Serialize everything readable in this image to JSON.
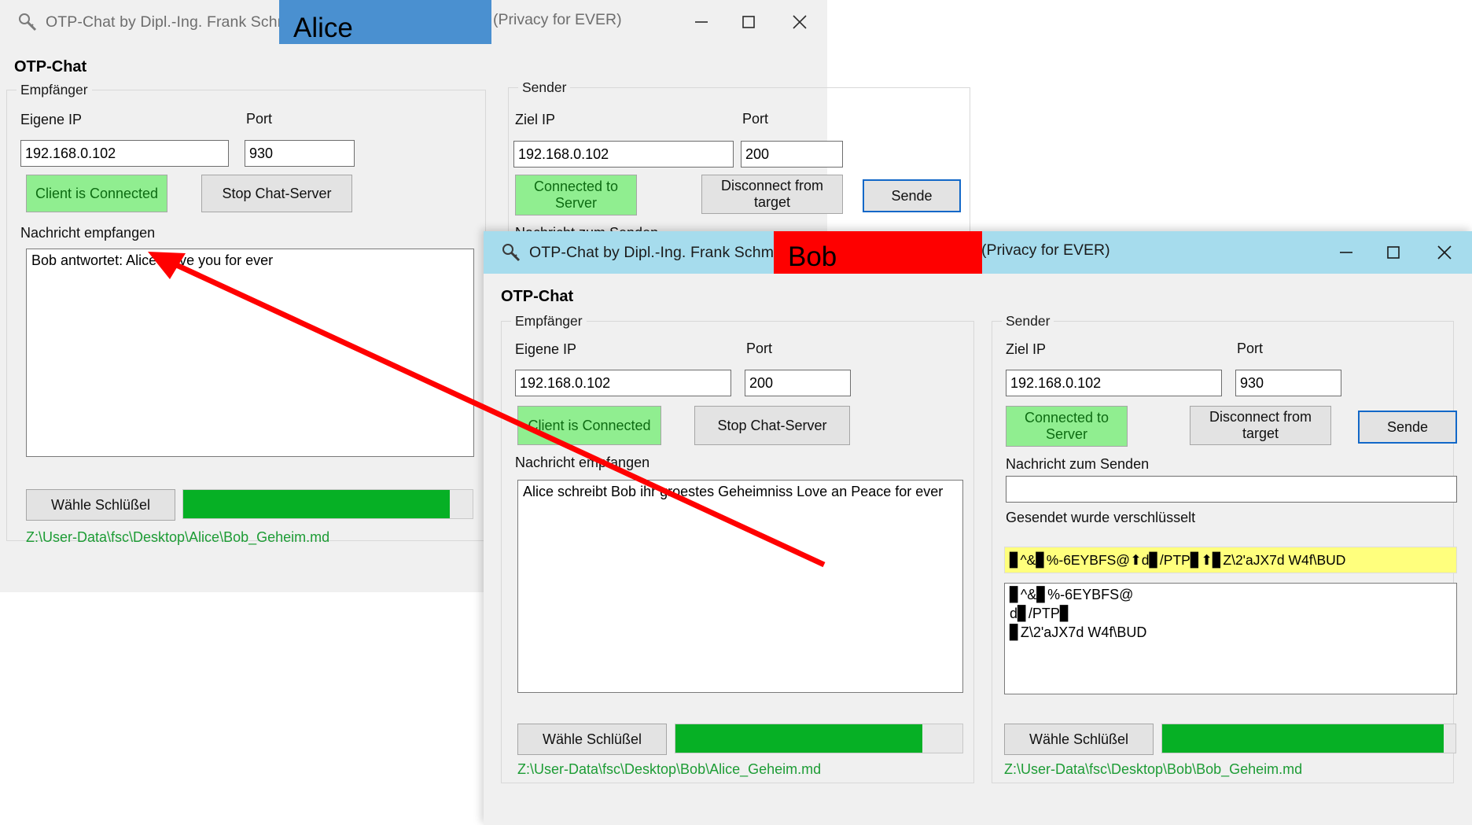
{
  "alice_window": {
    "titlebar": {
      "icon": "magnifier-key-icon",
      "title": "OTP-Chat by Dipl.-Ing. Frank Schmidt",
      "badge_label": "Alice",
      "badge_color": "#4a90d0",
      "tail": "(Privacy for EVER)",
      "minimize": "—",
      "maximize": "□",
      "close": "✕"
    },
    "app_title": "OTP-Chat",
    "receiver": {
      "legend": "Empfänger",
      "ip_label": "Eigene IP",
      "port_label": "Port",
      "ip_value": "192.168.0.102",
      "port_value": "930",
      "connect_button": "Client is Connected",
      "stop_button": "Stop Chat-Server",
      "received_label": "Nachricht empfangen",
      "received_text": "Bob antwortet: Alice I love you for ever",
      "key_button": "Wähle Schlüßel",
      "progress_percent": 92,
      "key_path": "Z:\\User-Data\\fsc\\Desktop\\Alice\\Bob_Geheim.md"
    },
    "sender": {
      "legend": "Sender",
      "ip_label": "Ziel IP",
      "port_label": "Port",
      "ip_value": "192.168.0.102",
      "port_value": "200",
      "connected_button": "Connected to Server",
      "disconnect_button": "Disconnect from target",
      "send_button": "Sende",
      "compose_label": "Nachricht zum Senden"
    }
  },
  "bob_window": {
    "titlebar": {
      "icon": "magnifier-key-icon",
      "title": "OTP-Chat by Dipl.-Ing. Frank Schmidt",
      "badge_label": "Bob",
      "badge_color": "#fe0000",
      "bar_color": "#a6dced",
      "tail": "(Privacy for EVER)",
      "minimize": "—",
      "maximize": "□",
      "close": "✕"
    },
    "app_title": "OTP-Chat",
    "receiver": {
      "legend": "Empfänger",
      "ip_label": "Eigene IP",
      "port_label": "Port",
      "ip_value": "192.168.0.102",
      "port_value": "200",
      "connect_button": "Client is Connected",
      "stop_button": "Stop Chat-Server",
      "received_label": "Nachricht empfangen",
      "received_text": "Alice schreibt Bob ihr groestes Geheimniss Love an Peace for ever",
      "key_button": "Wähle Schlüßel",
      "progress_percent": 86,
      "key_path": "Z:\\User-Data\\fsc\\Desktop\\Bob\\Alice_Geheim.md"
    },
    "sender": {
      "legend": "Sender",
      "ip_label": "Ziel IP",
      "port_label": "Port",
      "ip_value": "192.168.0.102",
      "port_value": "930",
      "connected_button": "Connected to Server",
      "disconnect_button": "Disconnect from target",
      "send_button": "Sende",
      "compose_label": "Nachricht zum Senden",
      "compose_value": "",
      "status_label": "Gesendet wurde verschlüsselt",
      "cipher_line": "▊^&▊%-6EYBFS@⬆d▊/PTP▊⬆▊Z\\2'aJX7d W4f\\BUD",
      "cipher_block": "▊^&▊%-6EYBFS@\nd▊/PTP▊\n▊Z\\2'aJX7d W4f\\BUD",
      "key_button": "Wähle Schlüßel",
      "progress_percent": 96,
      "key_path": "Z:\\User-Data\\fsc\\Desktop\\Bob\\Bob_Geheim.md"
    }
  },
  "annotation": {
    "arrow_color": "#ff0000",
    "name": "red-pointer-arrow"
  }
}
